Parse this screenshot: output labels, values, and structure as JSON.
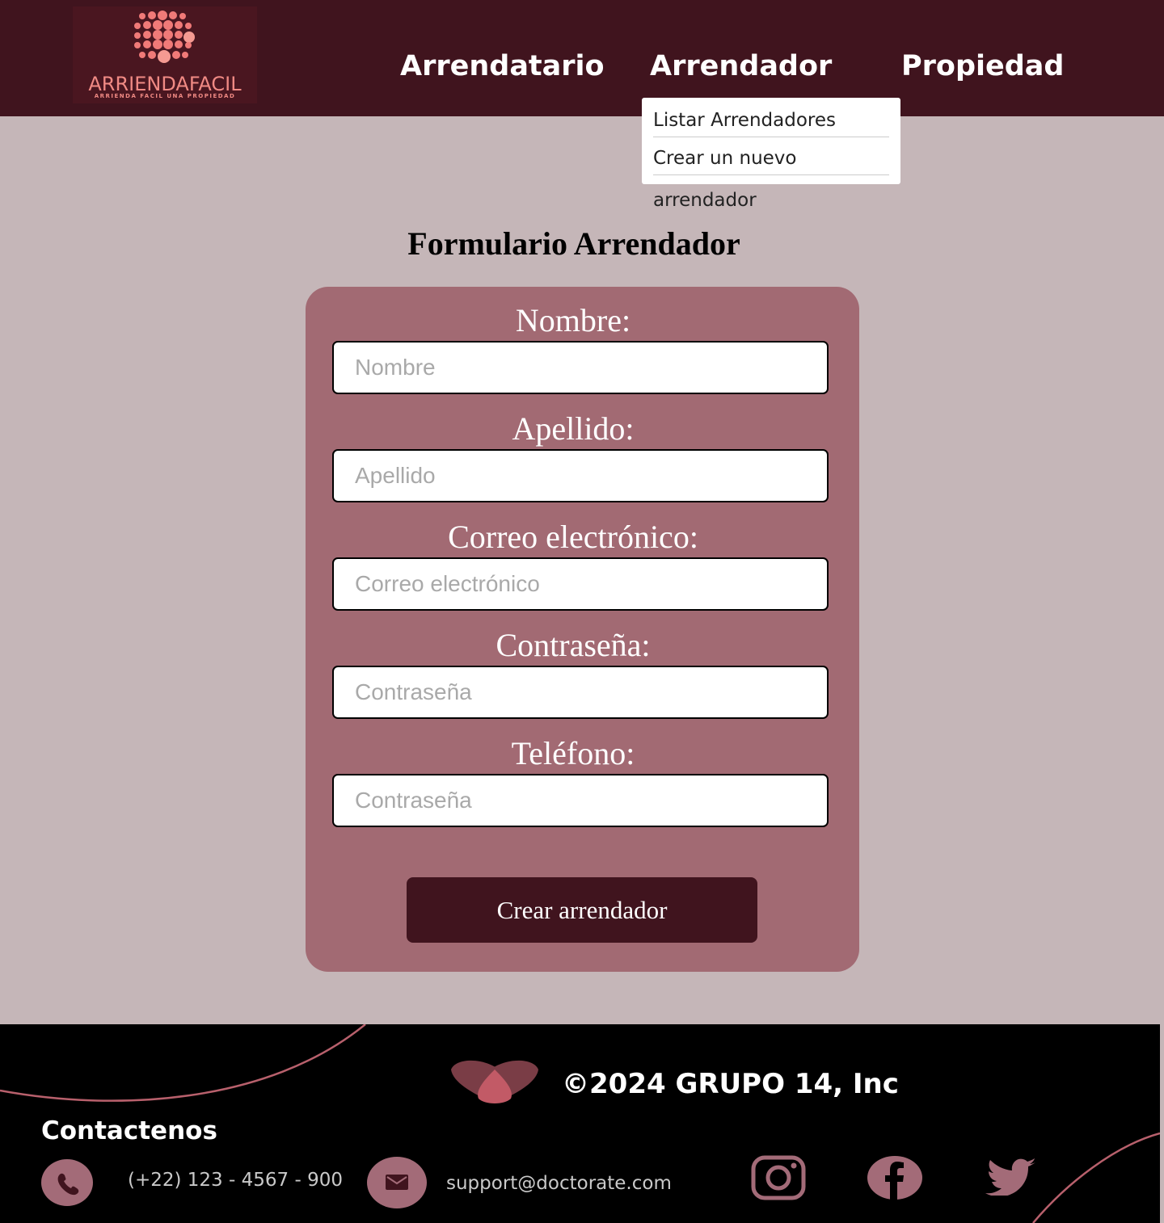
{
  "header": {
    "logo": {
      "name": "ARRIENDAFACIL",
      "tagline": "ARRIENDA FACIL UNA PROPIEDAD"
    },
    "nav": [
      {
        "label": "Arrendatario"
      },
      {
        "label": "Arrendador"
      },
      {
        "label": "Propiedad"
      }
    ],
    "dropdown": [
      {
        "label": "Listar Arrendadores"
      },
      {
        "label": "Crear un nuevo arrendador"
      }
    ]
  },
  "form": {
    "title": "Formulario Arrendador",
    "fields": [
      {
        "label": "Nombre:",
        "placeholder": "Nombre",
        "value": ""
      },
      {
        "label": "Apellido:",
        "placeholder": "Apellido",
        "value": ""
      },
      {
        "label": "Correo electrónico:",
        "placeholder": "Correo electrónico",
        "value": ""
      },
      {
        "label": "Contraseña:",
        "placeholder": "Contraseña",
        "value": ""
      },
      {
        "label": "Teléfono:",
        "placeholder": "Contraseña",
        "value": ""
      }
    ],
    "submit_label": "Crear arrendador"
  },
  "footer": {
    "copyright": "©2024 GRUPO 14, Inc",
    "contact_title": "Contactenos",
    "phone": "(+22) 123 - 4567 - 900",
    "email": "support@doctorate.com",
    "social": [
      "instagram-icon",
      "facebook-icon",
      "twitter-icon"
    ]
  },
  "colors": {
    "header_bg": "#40141e",
    "page_bg": "#c5b6b8",
    "card_bg": "#a26a73",
    "button_bg": "#40141e",
    "footer_bg": "#000000",
    "accent": "#a36b78"
  }
}
